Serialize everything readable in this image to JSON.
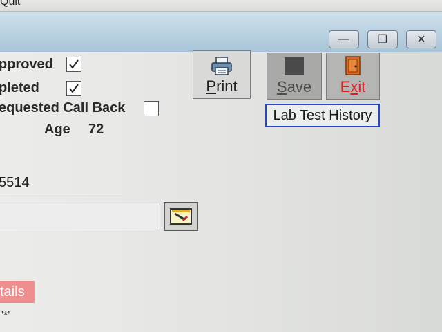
{
  "menu": {
    "item": "Quit"
  },
  "window_controls": {
    "minimize_symbol": "—",
    "restore_symbol": "❐",
    "close_symbol": "✕"
  },
  "checkboxes": [
    {
      "label": "pproved",
      "checked": true
    },
    {
      "label": "pleted",
      "checked": true
    },
    {
      "label": "equested Call Back",
      "checked": false
    }
  ],
  "patient": {
    "age_label": "Age",
    "age_value": "72",
    "number_fragment": "5514"
  },
  "toolbar": {
    "print_label_underlined": "P",
    "print_label_rest": "rint",
    "save_label_underlined": "S",
    "save_label_rest": "ave",
    "exit_label_first": "E",
    "exit_label_underlined": "x",
    "exit_label_rest": "it",
    "lab_history_label": "Lab Test History"
  },
  "details_tab": {
    "label": "tails"
  },
  "footnote": {
    "text": "'*'"
  },
  "colors": {
    "exit_text": "#e02020",
    "details_tab_bg": "#ee8e8e",
    "focus_border": "#2448c8"
  },
  "icons": [
    "printer-icon",
    "save-icon",
    "exit-door-icon",
    "lookup-icon",
    "check-icon"
  ]
}
